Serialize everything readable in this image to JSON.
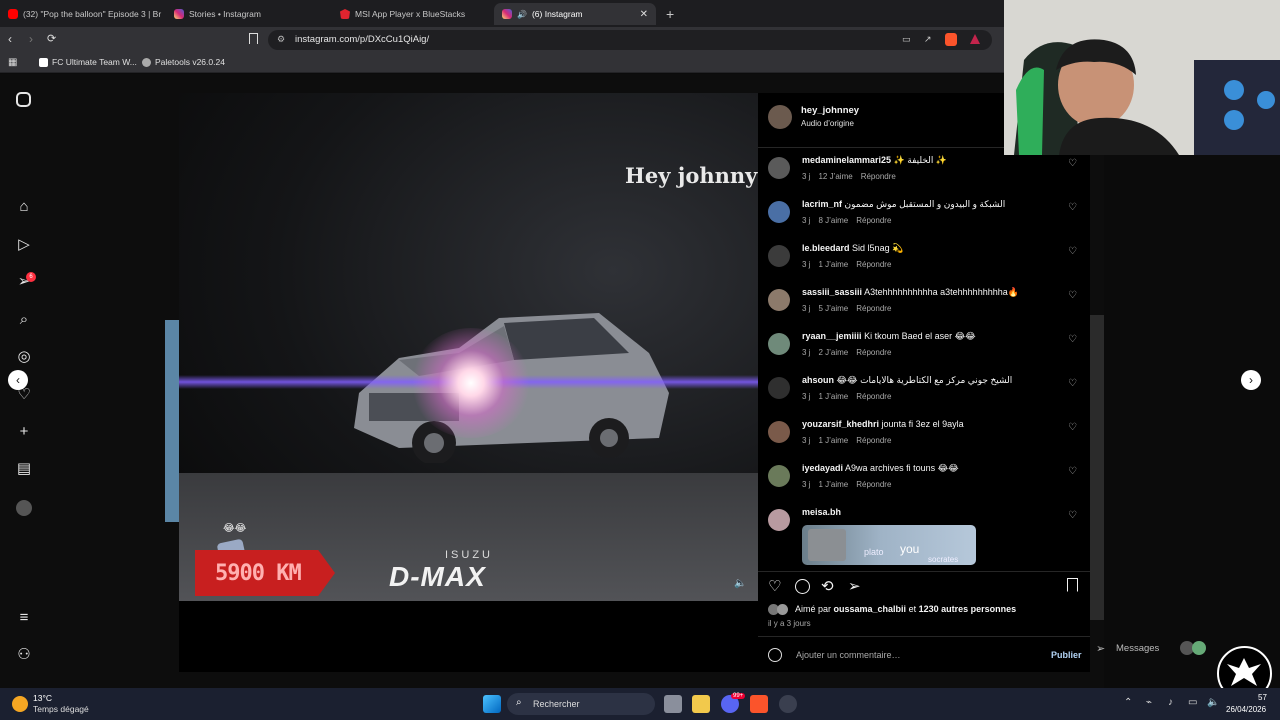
{
  "browser": {
    "tabs": [
      {
        "title": "(32) \"Pop the balloon\" Episode 3 | Br",
        "color": "#ff0000",
        "active": false
      },
      {
        "title": "Stories • Instagram",
        "color": "#d6249f",
        "active": false
      },
      {
        "title": "MSI App Player x BlueStacks",
        "color": "#e0242f",
        "active": false
      },
      {
        "title": "(6) Instagram",
        "color": "#d6249f",
        "active": true
      }
    ],
    "new_tab": "+",
    "url": "instagram.com/p/DXcCu1QiAig/",
    "bookmarks": [
      {
        "label": "FC Ultimate Team W..."
      },
      {
        "label": "Paletools v26.0.24"
      }
    ]
  },
  "sidebar": {
    "notification_badge": "6"
  },
  "video": {
    "overlay_title": "Hey johnny",
    "km_text": "5900 KM",
    "brand_top": "ISUZU",
    "brand_main": "D-MAX",
    "sticker_emoji": "😂😂"
  },
  "post": {
    "username": "hey_johnney",
    "audio": "Audio d’origine"
  },
  "comments": [
    {
      "user": "medaminelammari25",
      "text": "✨ الخليفة ✨",
      "age": "3 j",
      "likes": "12 J’aime",
      "reply": "Répondre",
      "avatar": "#5a5a5a"
    },
    {
      "user": "lacrim_nf",
      "text": "الشبكة و البيدون و المستقبل موش مضمون",
      "age": "3 j",
      "likes": "8 J’aime",
      "reply": "Répondre",
      "avatar": "#4a6fa5"
    },
    {
      "user": "le.bleedard",
      "text": "Sid l5nag 💫",
      "age": "3 j",
      "likes": "1 J’aime",
      "reply": "Répondre",
      "avatar": "#3b3b3b"
    },
    {
      "user": "sassiii_sassiii",
      "text": "A3tehhhhhhhhhha a3tehhhhhhhhha🔥",
      "age": "3 j",
      "likes": "5 J’aime",
      "reply": "Répondre",
      "avatar": "#8c7a6b"
    },
    {
      "user": "ryaan__jemiiii",
      "text": "Ki tkoum Baed el aser 😂😂",
      "age": "3 j",
      "likes": "2 J’aime",
      "reply": "Répondre",
      "avatar": "#6f8a7a"
    },
    {
      "user": "ahsoun",
      "text": "😂😂 الشيخ جوني مركز مع الكتاطرية هالايامات",
      "age": "3 j",
      "likes": "1 J’aime",
      "reply": "Répondre",
      "avatar": "#2f2f2f"
    },
    {
      "user": "youzarsif_khedhri",
      "text": "jounta fi 3ez el 9ayla",
      "age": "3 j",
      "likes": "1 J’aime",
      "reply": "Répondre",
      "avatar": "#7a5a4a"
    },
    {
      "user": "iyedayadi",
      "text": "A9wa archives fi touns 😂😂",
      "age": "3 j",
      "likes": "1 J’aime",
      "reply": "Répondre",
      "avatar": "#6a7a5a"
    },
    {
      "user": "meisa.bh",
      "text": "",
      "age": "",
      "likes": "",
      "reply": "",
      "avatar": "#b89aa0"
    }
  ],
  "sticker_texts": [
    "plato",
    "you",
    "socrates"
  ],
  "liked_by": {
    "prefix": "Aimé par ",
    "user": "oussama_chalbii",
    "middle": " et ",
    "others": "1230 autres personnes"
  },
  "post_time": "il y a 3 jours",
  "comment_placeholder": "Ajouter un commentaire…",
  "publish_label": "Publier",
  "messages_label": "Messages",
  "taskbar": {
    "temp": "13°C",
    "weather": "Temps dégagé",
    "search": "Rechercher",
    "time": "57",
    "date": "26/04/2026",
    "app_badge": "99+"
  },
  "colors": {
    "accent": "#0095f6",
    "ig_pink": "#d6249f",
    "brave": "#fb542b"
  }
}
